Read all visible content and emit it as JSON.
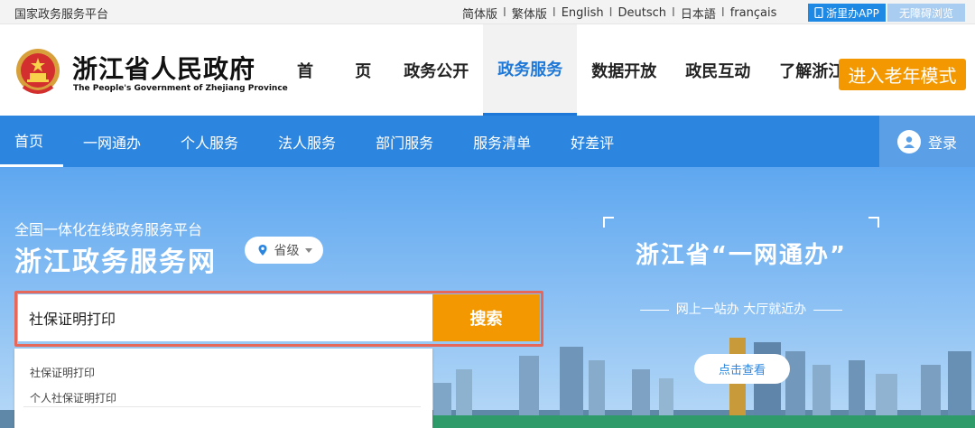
{
  "topbar": {
    "site_name": "国家政务服务平台",
    "languages": [
      "简体版",
      "繁体版",
      "English",
      "Deutsch",
      "日本語",
      "français"
    ],
    "separator": "I",
    "app_button": "浙里办APP",
    "accessibility_button": "无障碍浏览"
  },
  "header": {
    "title_cn": "浙江省人民政府",
    "title_en": "The People's Government of Zhejiang Province",
    "nav": [
      "首 页",
      "政务公开",
      "政务服务",
      "数据开放",
      "政民互动",
      "了解浙江"
    ],
    "active_nav": "政务服务",
    "elder_mode_button": "进入老年模式"
  },
  "subnav": {
    "items": [
      "首页",
      "一网通办",
      "个人服务",
      "法人服务",
      "部门服务",
      "服务清单",
      "好差评"
    ],
    "login_label": "登录"
  },
  "hero": {
    "subtitle": "全国一体化在线政务服务平台",
    "title": "浙江政务服务网",
    "region_label": "省级",
    "search_value": "社保证明打印",
    "search_button": "搜索",
    "suggestions": [
      "社保证明打印",
      "个人社保证明打印"
    ]
  },
  "promo": {
    "title": "浙江省“一网通办”",
    "subtitle": "网上一站办 大厅就近办",
    "button": "点击查看"
  },
  "colors": {
    "primary_blue": "#2c86e0",
    "orange": "#f39800",
    "highlight_red": "#e5685b"
  }
}
